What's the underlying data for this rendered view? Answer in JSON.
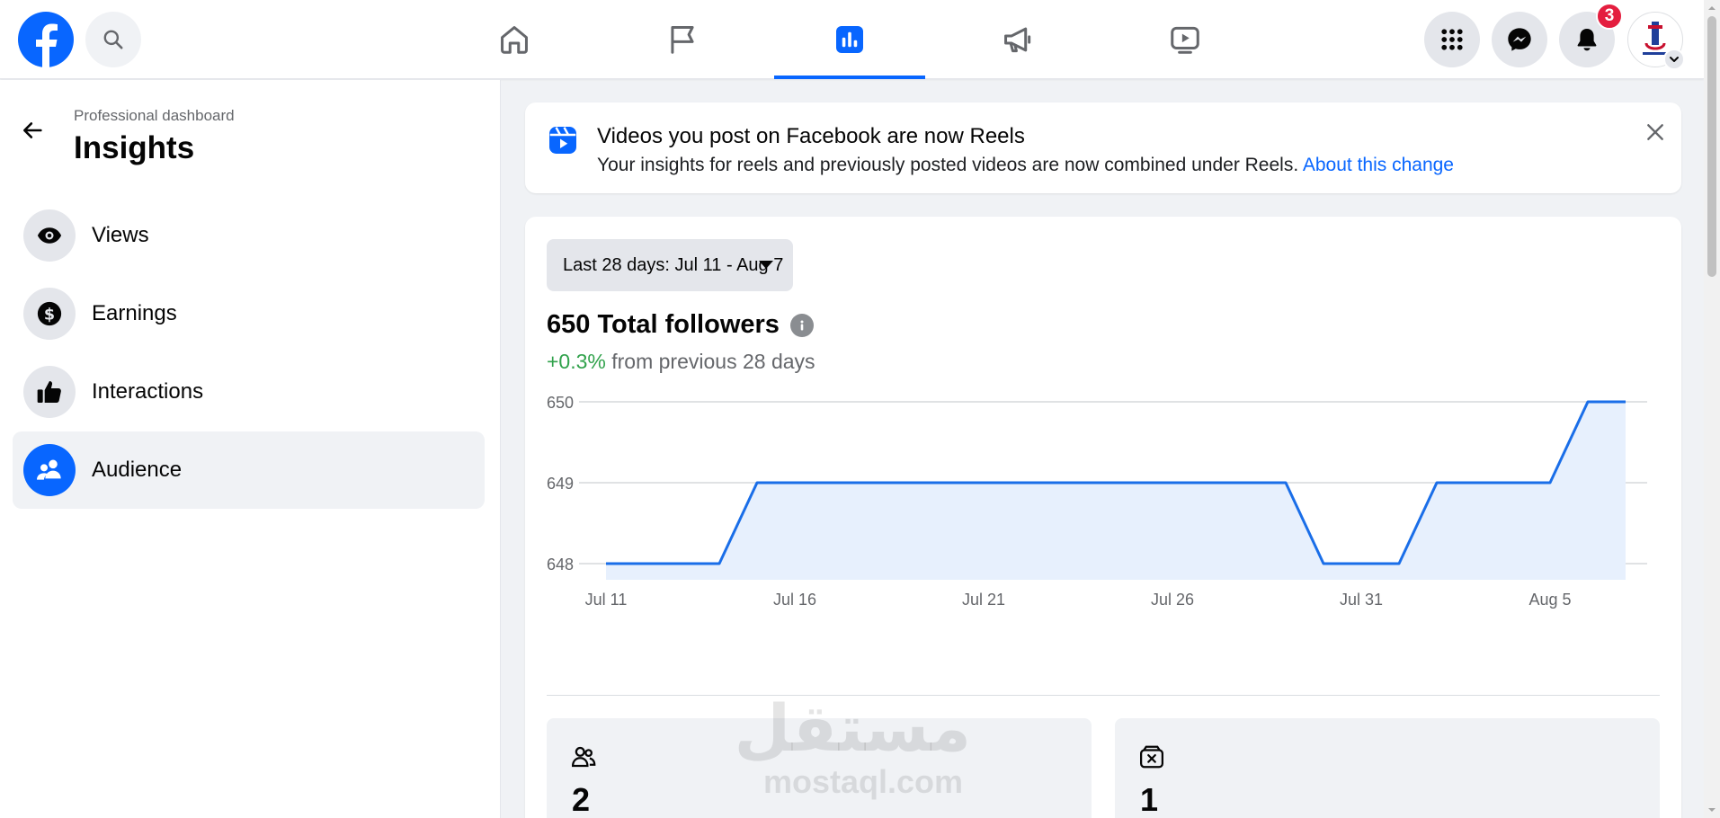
{
  "topnav": {
    "tabs": [
      "home",
      "pages",
      "insights",
      "ads",
      "video"
    ],
    "active_tab": "insights",
    "notification_count": "3"
  },
  "sidebar": {
    "breadcrumb": "Professional dashboard",
    "title": "Insights",
    "items": [
      {
        "label": "Views",
        "icon": "eye-icon"
      },
      {
        "label": "Earnings",
        "icon": "dollar-icon"
      },
      {
        "label": "Interactions",
        "icon": "thumbs-up-icon"
      },
      {
        "label": "Audience",
        "icon": "people-icon",
        "active": true
      }
    ]
  },
  "banner": {
    "title": "Videos you post on Facebook are now Reels",
    "text": "Your insights for reels and previously posted videos are now combined under Reels.",
    "link": "About this change"
  },
  "card": {
    "date_range": "Last 28 days: Jul 11 - Aug 7",
    "followers_title": "650 Total followers",
    "change_value": "+0.3%",
    "change_text": "from previous 28 days",
    "stats": [
      {
        "value": "2",
        "icon": "people-outline-icon"
      },
      {
        "value": "1",
        "icon": "unfollow-icon"
      }
    ]
  },
  "chart_data": {
    "type": "area",
    "x": [
      "Jul 11",
      "Jul 12",
      "Jul 13",
      "Jul 14",
      "Jul 15",
      "Jul 16",
      "Jul 17",
      "Jul 18",
      "Jul 19",
      "Jul 20",
      "Jul 21",
      "Jul 22",
      "Jul 23",
      "Jul 24",
      "Jul 25",
      "Jul 26",
      "Jul 27",
      "Jul 28",
      "Jul 29",
      "Jul 30",
      "Jul 31",
      "Aug 1",
      "Aug 2",
      "Aug 3",
      "Aug 4",
      "Aug 5",
      "Aug 6",
      "Aug 7"
    ],
    "x_tick_labels": [
      "Jul 11",
      "Jul 16",
      "Jul 21",
      "Jul 26",
      "Jul 31",
      "Aug 5"
    ],
    "values": [
      648,
      648,
      648,
      648,
      649,
      649,
      649,
      649,
      649,
      649,
      649,
      649,
      649,
      649,
      649,
      649,
      649,
      649,
      649,
      648,
      648,
      648,
      649,
      649,
      649,
      649,
      650,
      650
    ],
    "y_ticks": [
      648,
      649,
      650
    ],
    "ylim": [
      648,
      650
    ],
    "grid": true,
    "line_color": "#1a6ee8",
    "fill_color": "#e7f0fd"
  },
  "watermark": {
    "arabic": "مستقل",
    "latin": "mostaql.com"
  },
  "colors": {
    "accent": "#0866ff",
    "positive": "#31a24c",
    "badge": "#e41e3f"
  }
}
